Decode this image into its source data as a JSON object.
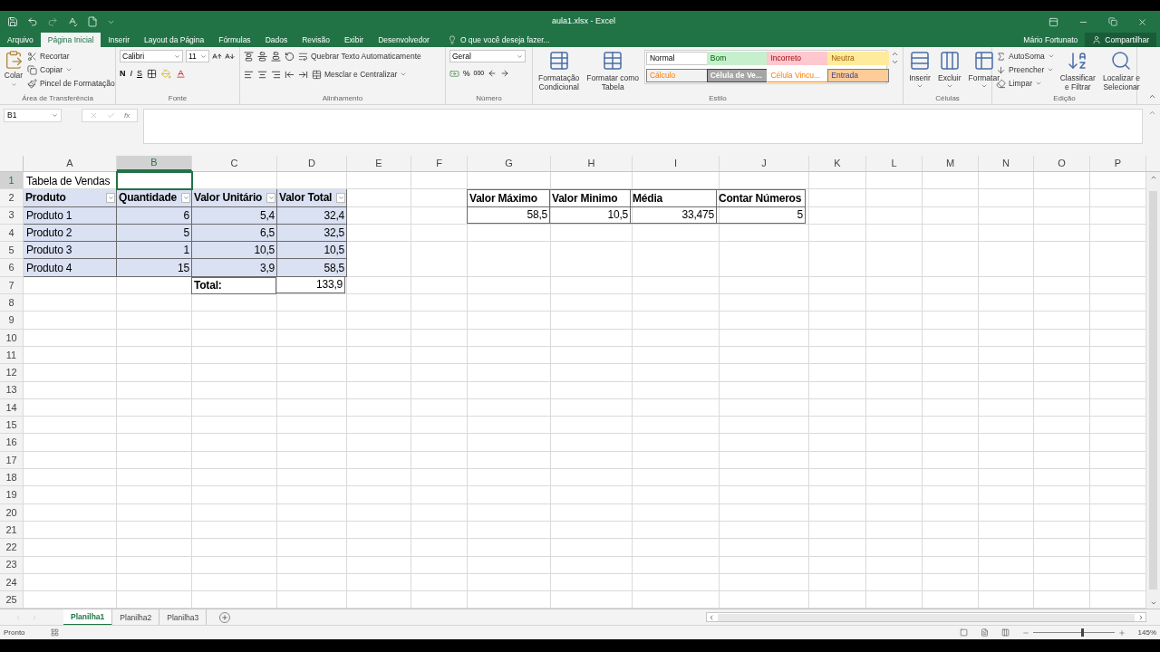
{
  "window": {
    "title": "aula1.xlsx - Excel"
  },
  "menu_tabs": [
    {
      "label": "Arquivo",
      "selected": false
    },
    {
      "label": "Página Inicial",
      "selected": true
    },
    {
      "label": "Inserir",
      "selected": false
    },
    {
      "label": "Layout da Página",
      "selected": false
    },
    {
      "label": "Fórmulas",
      "selected": false
    },
    {
      "label": "Dados",
      "selected": false
    },
    {
      "label": "Revisão",
      "selected": false
    },
    {
      "label": "Exibir",
      "selected": false
    },
    {
      "label": "Desenvolvedor",
      "selected": false
    }
  ],
  "tell_me": {
    "placeholder": "O que você deseja fazer..."
  },
  "user": "Mário Fortunato",
  "share": "Compartilhar",
  "ribbon": {
    "clipboard": {
      "paste": "Colar",
      "cut": "Recortar",
      "copy": "Copiar",
      "format_painter": "Pincel de Formatação",
      "label": "Área de Transferência"
    },
    "font": {
      "name": "Calibri",
      "size": "11",
      "bold": "N",
      "italic": "I",
      "underline": "S",
      "label": "Fonte"
    },
    "alignment": {
      "wrap": "Quebrar Texto Automaticamente",
      "merge": "Mesclar e Centralizar",
      "label": "Alinhamento"
    },
    "number": {
      "format": "Geral",
      "percent": "%",
      "thousands": "000",
      "label": "Número"
    },
    "styles": {
      "conditional": [
        "Formatação",
        "Condicional"
      ],
      "as_table": [
        "Formatar como",
        "Tabela"
      ],
      "label": "Estilo",
      "gallery": [
        {
          "label": "Normal",
          "kind": "normal"
        },
        {
          "label": "Bom",
          "kind": "good"
        },
        {
          "label": "Incorreto",
          "kind": "bad"
        },
        {
          "label": "Neutra",
          "kind": "neutral"
        },
        {
          "label": "Cálculo",
          "kind": "calc"
        },
        {
          "label": "Célula de Ve...",
          "kind": "check"
        },
        {
          "label": "Célula Vincu...",
          "kind": "linked"
        },
        {
          "label": "Entrada",
          "kind": "input"
        }
      ]
    },
    "cells": {
      "insert": "Inserir",
      "delete": "Excluir",
      "format": "Formatar",
      "label": "Células"
    },
    "editing": {
      "autosum": "AutoSoma",
      "fill": "Preencher",
      "clear": "Limpar",
      "sort": [
        "Classificar",
        "e Filtrar"
      ],
      "find": [
        "Localizar e",
        "Selecionar"
      ],
      "label": "Edição"
    }
  },
  "formula_bar": {
    "name_box": "B1",
    "fx": "fx"
  },
  "sheet": {
    "columns": [
      {
        "label": "A",
        "selected": false
      },
      {
        "label": "B",
        "selected": true
      },
      {
        "label": "C",
        "selected": false
      },
      {
        "label": "D",
        "selected": false
      },
      {
        "label": "E",
        "selected": false
      },
      {
        "label": "F",
        "selected": false
      },
      {
        "label": "G",
        "selected": false
      },
      {
        "label": "H",
        "selected": false
      },
      {
        "label": "I",
        "selected": false
      },
      {
        "label": "J",
        "selected": false
      },
      {
        "label": "K",
        "selected": false
      },
      {
        "label": "L",
        "selected": false
      },
      {
        "label": "M",
        "selected": false
      },
      {
        "label": "N",
        "selected": false
      },
      {
        "label": "O",
        "selected": false
      },
      {
        "label": "P",
        "selected": false
      }
    ],
    "rows": [
      {
        "label": "1",
        "selected": true,
        "cells": [
          {
            "kind": "text",
            "text": "Tabela de Vendas"
          }
        ]
      },
      {
        "label": "2",
        "selected": false,
        "cells": [
          {
            "kind": "table_header",
            "text": "Produto"
          },
          {
            "kind": "table_header",
            "text": "Quantidade"
          },
          {
            "kind": "table_header",
            "text": "Valor Unitário"
          },
          {
            "kind": "table_header",
            "text": "Valor Total"
          },
          {
            "kind": "empty"
          },
          {
            "kind": "empty"
          },
          {
            "kind": "bordered_bold",
            "text": "Valor Máximo"
          },
          {
            "kind": "bordered_bold",
            "text": "Valor Minimo"
          },
          {
            "kind": "bordered_bold",
            "text": "Média"
          },
          {
            "kind": "bordered_bold",
            "text": "Contar Números"
          }
        ]
      },
      {
        "label": "3",
        "selected": false,
        "cells": [
          {
            "kind": "table_text",
            "text": "Produto 1"
          },
          {
            "kind": "table_number",
            "text": "6"
          },
          {
            "kind": "table_number",
            "text": "5,4"
          },
          {
            "kind": "table_number",
            "text": "32,4"
          },
          {
            "kind": "empty"
          },
          {
            "kind": "empty"
          },
          {
            "kind": "bordered_number",
            "text": "58,5"
          },
          {
            "kind": "bordered_number",
            "text": "10,5"
          },
          {
            "kind": "bordered_number",
            "text": "33,475"
          },
          {
            "kind": "bordered_number",
            "text": "5"
          }
        ]
      },
      {
        "label": "4",
        "selected": false,
        "cells": [
          {
            "kind": "table_text",
            "text": "Produto 2"
          },
          {
            "kind": "table_number",
            "text": "5"
          },
          {
            "kind": "table_number",
            "text": "6,5"
          },
          {
            "kind": "table_number",
            "text": "32,5"
          }
        ]
      },
      {
        "label": "5",
        "selected": false,
        "cells": [
          {
            "kind": "table_text",
            "text": "Produto 3"
          },
          {
            "kind": "table_number",
            "text": "1"
          },
          {
            "kind": "table_number",
            "text": "10,5"
          },
          {
            "kind": "table_number",
            "text": "10,5"
          }
        ]
      },
      {
        "label": "6",
        "selected": false,
        "cells": [
          {
            "kind": "table_text",
            "text": "Produto 4"
          },
          {
            "kind": "table_number",
            "text": "15"
          },
          {
            "kind": "table_number",
            "text": "3,9"
          },
          {
            "kind": "table_number",
            "text": "58,5"
          }
        ]
      },
      {
        "label": "7",
        "selected": false,
        "cells": [
          {
            "kind": "empty"
          },
          {
            "kind": "empty"
          },
          {
            "kind": "bordered_bold",
            "text": "Total:"
          },
          {
            "kind": "bordered_number",
            "text": "133,9"
          }
        ]
      },
      {
        "label": "8",
        "selected": false
      },
      {
        "label": "9",
        "selected": false
      },
      {
        "label": "10",
        "selected": false
      },
      {
        "label": "11",
        "selected": false
      },
      {
        "label": "12",
        "selected": false
      },
      {
        "label": "13",
        "selected": false
      },
      {
        "label": "14",
        "selected": false
      },
      {
        "label": "15",
        "selected": false
      },
      {
        "label": "16",
        "selected": false
      },
      {
        "label": "17",
        "selected": false
      },
      {
        "label": "18",
        "selected": false
      },
      {
        "label": "19",
        "selected": false
      },
      {
        "label": "20",
        "selected": false
      },
      {
        "label": "21",
        "selected": false
      },
      {
        "label": "22",
        "selected": false
      },
      {
        "label": "23",
        "selected": false
      },
      {
        "label": "24",
        "selected": false
      },
      {
        "label": "25",
        "selected": false
      }
    ]
  },
  "sheet_tabs": [
    {
      "label": "Planilha1",
      "selected": true
    },
    {
      "label": "Planilha2",
      "selected": false
    },
    {
      "label": "Planilha3",
      "selected": false
    }
  ],
  "status_bar": {
    "status": "Pronto",
    "zoom": {
      "label": "145%",
      "level": 0.6
    }
  }
}
